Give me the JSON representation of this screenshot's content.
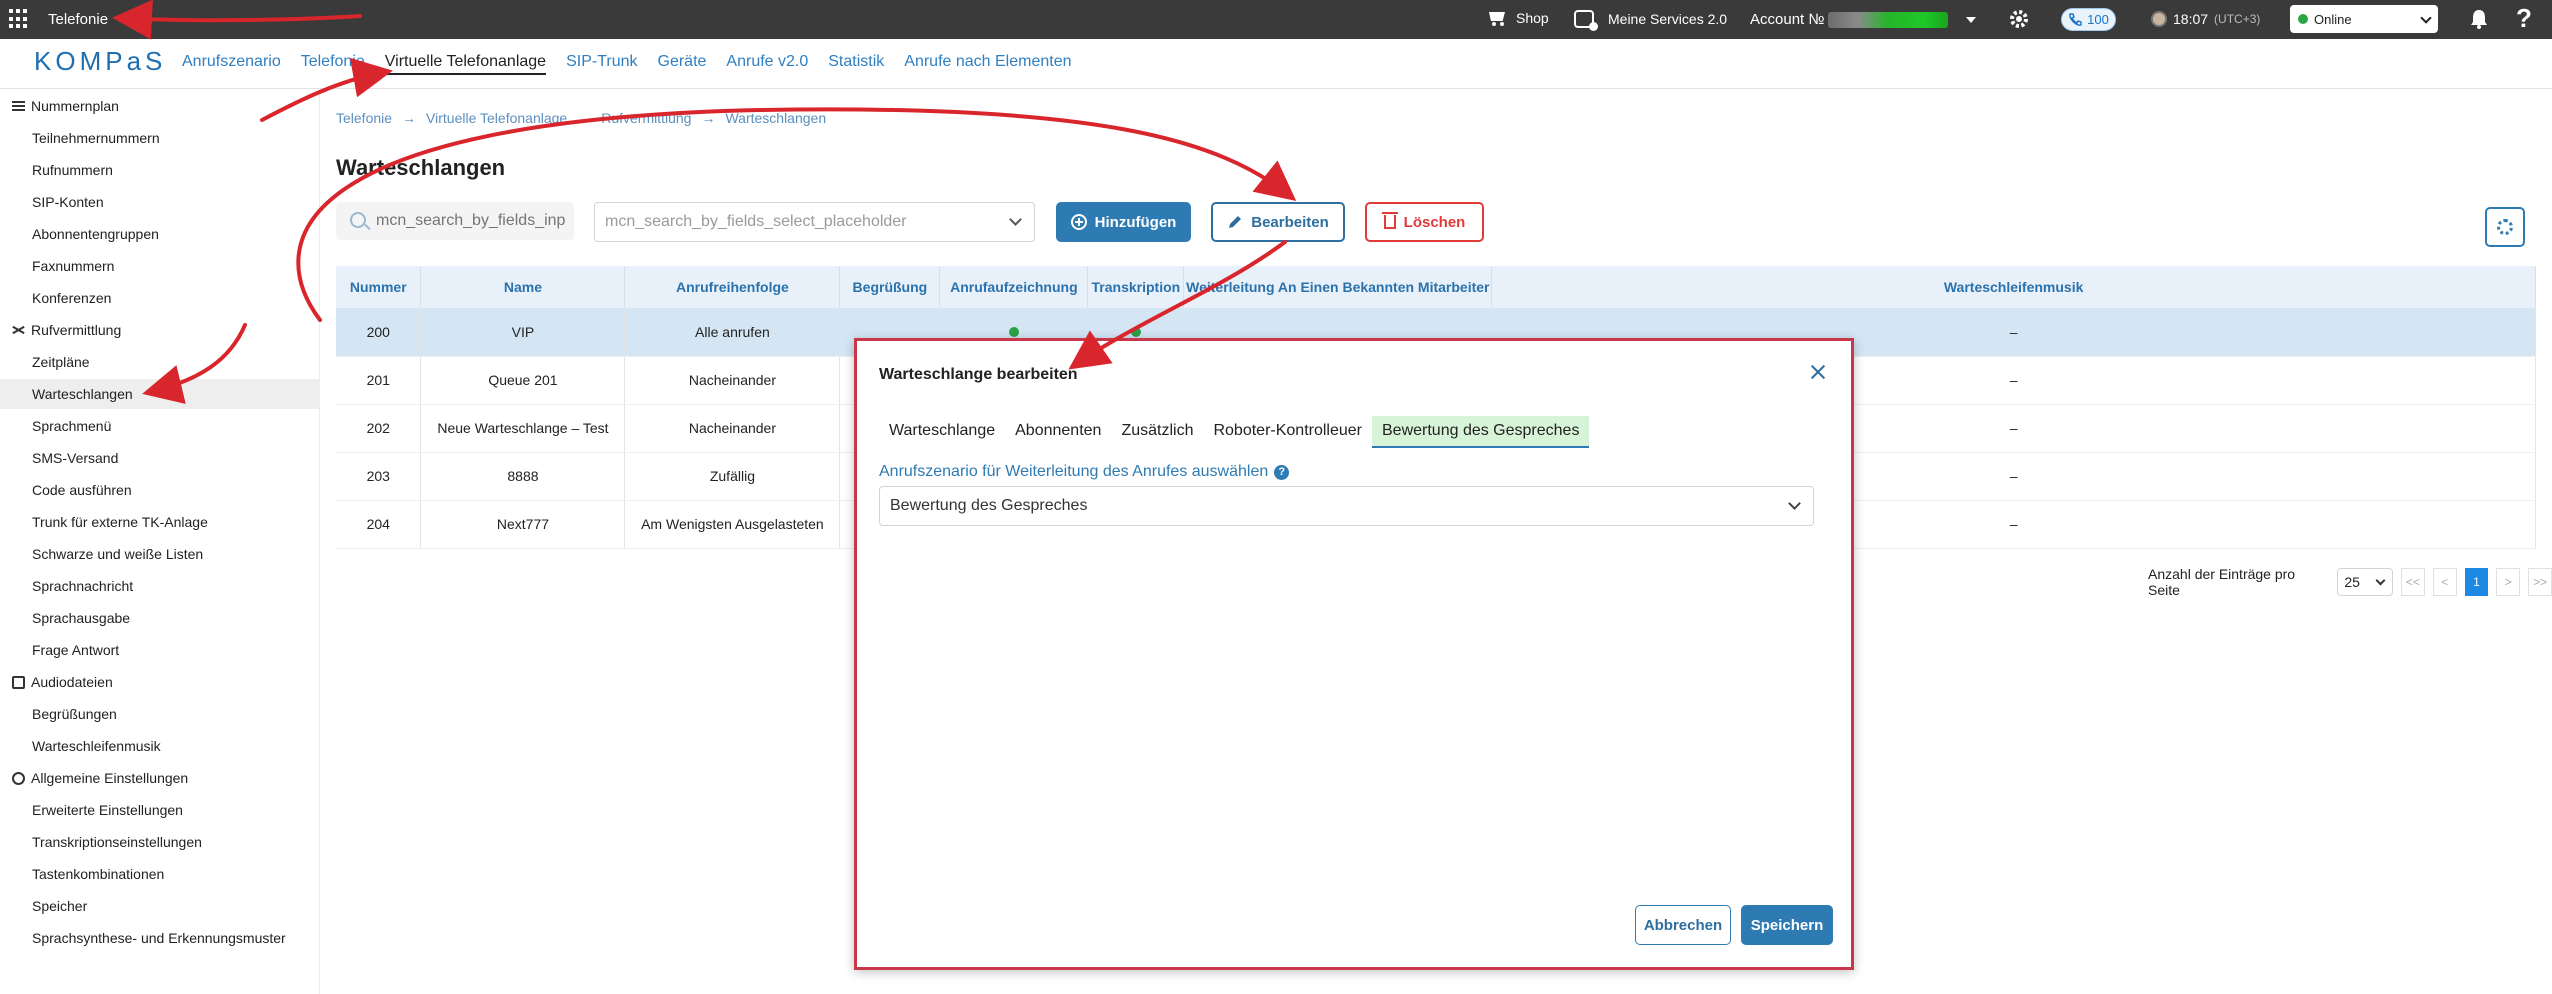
{
  "topbar": {
    "app_title": "Telefonie",
    "shop": "Shop",
    "services": "Meine Services 2.0",
    "account": "Account №",
    "calls_count": "100",
    "time": "18:07",
    "timezone": "(UTC+3)",
    "status": "Online",
    "help": "?"
  },
  "nav": {
    "logo": "KOMPaS",
    "links": [
      "Anrufszenario",
      "Telefonie",
      "Virtuelle Telefonanlage",
      "SIP-Trunk",
      "Geräte",
      "Anrufe v2.0",
      "Statistik",
      "Anrufe nach Elementen"
    ],
    "active_index": 2
  },
  "sidebar": {
    "groups": [
      {
        "label": "Nummernplan",
        "items": [
          "Teilnehmernummern",
          "Rufnummern",
          "SIP-Konten",
          "Abonnentengruppen",
          "Faxnummern",
          "Konferenzen"
        ]
      },
      {
        "label": "Rufvermittlung",
        "items": [
          "Zeitpläne",
          "Warteschlangen",
          "Sprachmenü",
          "SMS-Versand",
          "Code ausführen",
          "Trunk für externe TK-Anlage",
          "Schwarze und weiße Listen",
          "Sprachnachricht",
          "Sprachausgabe",
          "Frage Antwort"
        ]
      },
      {
        "label": "Audiodateien",
        "items": [
          "Begrüßungen",
          "Warteschleifenmusik"
        ]
      },
      {
        "label": "Allgemeine Einstellungen",
        "items": [
          "Erweiterte Einstellungen",
          "Transkriptionseinstellungen",
          "Tastenkombinationen",
          "Speicher",
          "Sprachsynthese- und Erkennungsmuster"
        ]
      }
    ]
  },
  "breadcrumb": [
    "Telefonie",
    "→",
    "Virtuelle Telefonanlage",
    "→",
    "Rufvermittlung",
    "→",
    "Warteschlangen"
  ],
  "page_title": "Warteschlangen",
  "toolbar": {
    "search_placeholder": "mcn_search_by_fields_inp",
    "select_placeholder": "mcn_search_by_fields_select_placeholder",
    "add_label": "Hinzufügen",
    "edit_label": "Bearbeiten",
    "delete_label": "Löschen"
  },
  "table": {
    "headers": [
      "Nummer",
      "Name",
      "Anrufreihenfolge",
      "Begrüßung",
      "Anrufaufzeichnung",
      "Transkription",
      "Weiterleitung An Einen Bekannten Mitarbeiter",
      "Warteschleifenmusik"
    ],
    "rows": [
      [
        "200",
        "VIP",
        "Alle anrufen",
        "–"
      ],
      [
        "201",
        "Queue 201",
        "Nacheinander",
        "–"
      ],
      [
        "202",
        "Neue Warteschlange – Test",
        "Nacheinander",
        "–"
      ],
      [
        "203",
        "8888",
        "Zufällig",
        "–"
      ],
      [
        "204",
        "Next777",
        "Am Wenigsten Ausgelasteten",
        "–"
      ]
    ]
  },
  "pager": {
    "label": "Anzahl der Einträge pro Seite",
    "page_size": "25",
    "first": "<<",
    "prev": "<",
    "current": "1",
    "next": ">",
    "last": ">>"
  },
  "modal": {
    "title": "Warteschlange bearbeiten",
    "tabs": [
      "Warteschlange",
      "Abonnenten",
      "Zusätzlich",
      "Roboter-Kontrolleuer",
      "Bewertung des Gespreches"
    ],
    "active_tab": 4,
    "field_label": "Anrufszenario für Weiterleitung des Anrufes auswählen",
    "field_value": "Bewertung des Gespreches",
    "help_glyph": "?",
    "cancel_label": "Abbrechen",
    "save_label": "Speichern"
  },
  "colors": {
    "accent": "#2e7bb3",
    "danger": "#e03a3a",
    "annotation": "#d9262c",
    "topbar": "#3a3a3a"
  }
}
